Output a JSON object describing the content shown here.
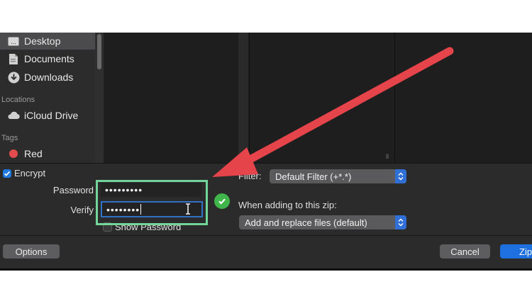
{
  "sidebar": {
    "items": [
      {
        "label": "Desktop",
        "icon": "desktop-icon",
        "selected": true
      },
      {
        "label": "Documents",
        "icon": "document-icon"
      },
      {
        "label": "Downloads",
        "icon": "downloads-icon"
      }
    ],
    "locations_header": "Locations",
    "locations": [
      {
        "label": "iCloud Drive",
        "icon": "cloud-icon"
      }
    ],
    "tags_header": "Tags",
    "tags": [
      {
        "label": "Red",
        "color": "#e34c4c"
      }
    ]
  },
  "options": {
    "encrypt_label": "Encrypt",
    "encrypt_checked": true,
    "password_label": "Password",
    "password_value": "•••••••••",
    "verify_label": "Verify",
    "verify_value": "••••••••",
    "show_password_label": "Show Password",
    "show_password_checked": false,
    "filter_label": "Filter:",
    "filter_value": "Default Filter (+*.*)",
    "when_adding_label": "When adding to this zip:",
    "when_adding_value": "Add and replace files (default)"
  },
  "buttons": {
    "options": "Options",
    "cancel": "Cancel",
    "zip": "Zip"
  },
  "colors": {
    "accent": "#1e6fe0",
    "highlight": "#74d59a",
    "arrow": "#e5444b",
    "ok": "#3fb54a"
  }
}
